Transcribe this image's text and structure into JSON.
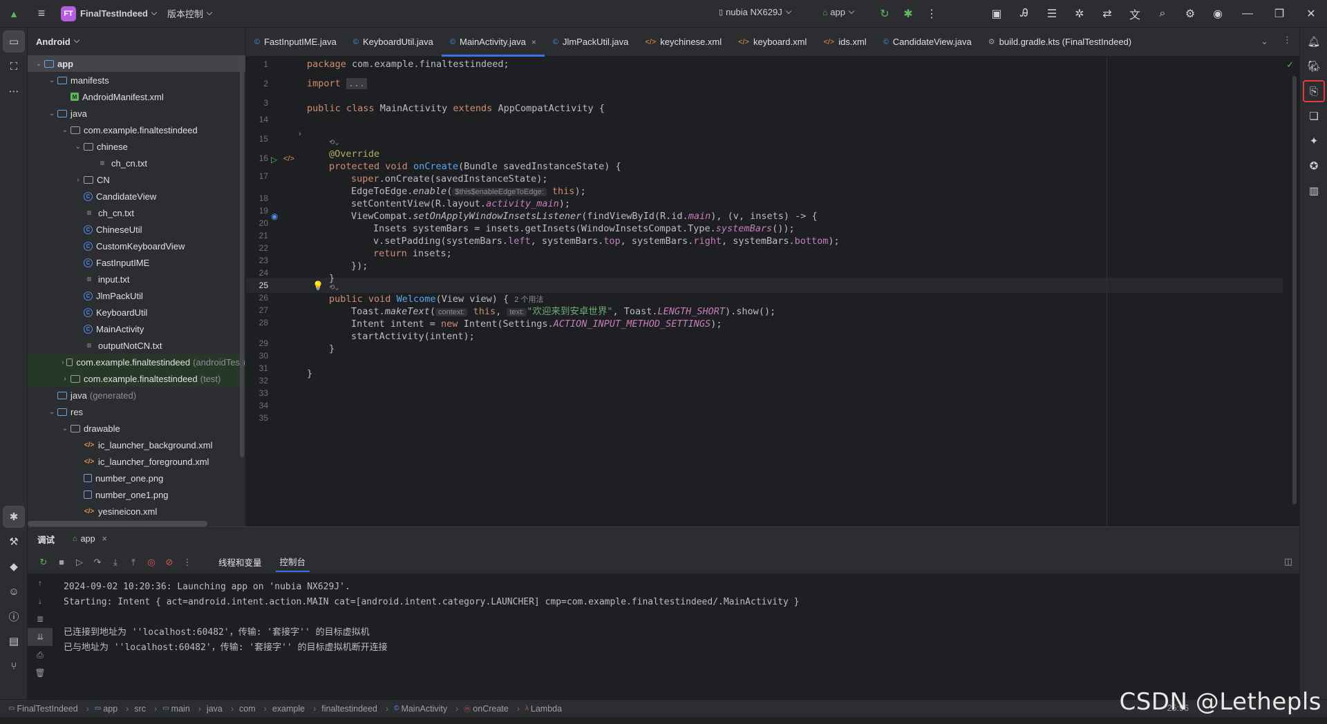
{
  "titlebar": {
    "project_badge": "FT",
    "project_name": "FinalTestIndeed",
    "vcs": "版本控制",
    "device": "nubia NX629J",
    "run_config": "app"
  },
  "project_panel": {
    "title": "Android",
    "tree": [
      {
        "label": "app",
        "indent": 0,
        "arrow": "v",
        "icon": "folder-module",
        "selected": true
      },
      {
        "label": "manifests",
        "indent": 1,
        "arrow": "v",
        "icon": "folder"
      },
      {
        "label": "AndroidManifest.xml",
        "indent": 2,
        "arrow": "",
        "icon": "manifest"
      },
      {
        "label": "java",
        "indent": 1,
        "arrow": "v",
        "icon": "folder"
      },
      {
        "label": "com.example.finaltestindeed",
        "indent": 2,
        "arrow": "v",
        "icon": "package"
      },
      {
        "label": "chinese",
        "indent": 3,
        "arrow": "v",
        "icon": "package"
      },
      {
        "label": "ch_cn.txt",
        "indent": 4,
        "arrow": "",
        "icon": "txt"
      },
      {
        "label": "CN",
        "indent": 3,
        "arrow": ">",
        "icon": "package"
      },
      {
        "label": "CandidateView",
        "indent": 3,
        "arrow": "",
        "icon": "class"
      },
      {
        "label": "ch_cn.txt",
        "indent": 3,
        "arrow": "",
        "icon": "txt"
      },
      {
        "label": "ChineseUtil",
        "indent": 3,
        "arrow": "",
        "icon": "class"
      },
      {
        "label": "CustomKeyboardView",
        "indent": 3,
        "arrow": "",
        "icon": "class"
      },
      {
        "label": "FastInputIME",
        "indent": 3,
        "arrow": "",
        "icon": "class"
      },
      {
        "label": "input.txt",
        "indent": 3,
        "arrow": "",
        "icon": "txt"
      },
      {
        "label": "JlmPackUtil",
        "indent": 3,
        "arrow": "",
        "icon": "class"
      },
      {
        "label": "KeyboardUtil",
        "indent": 3,
        "arrow": "",
        "icon": "class"
      },
      {
        "label": "MainActivity",
        "indent": 3,
        "arrow": "",
        "icon": "class"
      },
      {
        "label": "outputNotCN.txt",
        "indent": 3,
        "arrow": "",
        "icon": "txt"
      },
      {
        "label": "com.example.finaltestindeed",
        "suffix": "(androidTest)",
        "indent": 2,
        "arrow": ">",
        "icon": "package",
        "test": true
      },
      {
        "label": "com.example.finaltestindeed",
        "suffix": "(test)",
        "indent": 2,
        "arrow": ">",
        "icon": "package",
        "test": true
      },
      {
        "label": "java",
        "suffix": "(generated)",
        "indent": 1,
        "arrow": "",
        "icon": "folder"
      },
      {
        "label": "res",
        "indent": 1,
        "arrow": "v",
        "icon": "folder"
      },
      {
        "label": "drawable",
        "indent": 2,
        "arrow": "v",
        "icon": "package"
      },
      {
        "label": "ic_launcher_background.xml",
        "indent": 3,
        "arrow": "",
        "icon": "xml"
      },
      {
        "label": "ic_launcher_foreground.xml",
        "indent": 3,
        "arrow": "",
        "icon": "xml"
      },
      {
        "label": "number_one.png",
        "indent": 3,
        "arrow": "",
        "icon": "png"
      },
      {
        "label": "number_one1.png",
        "indent": 3,
        "arrow": "",
        "icon": "png"
      },
      {
        "label": "yesineicon.xml",
        "indent": 3,
        "arrow": "",
        "icon": "xml"
      }
    ]
  },
  "tabs": [
    {
      "label": "FastInputIME.java",
      "icon": "c"
    },
    {
      "label": "KeyboardUtil.java",
      "icon": "c"
    },
    {
      "label": "MainActivity.java",
      "icon": "c",
      "active": true
    },
    {
      "label": "JlmPackUtil.java",
      "icon": "c"
    },
    {
      "label": "keychinese.xml",
      "icon": "x"
    },
    {
      "label": "keyboard.xml",
      "icon": "x"
    },
    {
      "label": "ids.xml",
      "icon": "x"
    },
    {
      "label": "CandidateView.java",
      "icon": "c"
    },
    {
      "label": "build.gradle.kts (FinalTestIndeed)",
      "icon": "g"
    }
  ],
  "editor": {
    "line_numbers": [
      "1",
      "2",
      "3",
      "14",
      "15",
      "16",
      "17",
      "",
      "18",
      "19",
      "20",
      "21",
      "22",
      "23",
      "24",
      "25",
      "26",
      "27",
      "28",
      "",
      "29",
      "30",
      "31",
      "32",
      "33",
      "34",
      "35"
    ],
    "current_line": "25",
    "code": {
      "l1": [
        "package",
        " com.example.finaltestindeed;"
      ],
      "l3": [
        "import",
        "..."
      ],
      "l15": [
        "public",
        "class",
        "MainActivity",
        "extends",
        "AppCompatActivity {"
      ],
      "override": "@Override",
      "l19": [
        "protected",
        "void",
        "onCreate",
        "(Bundle savedInstanceState) {"
      ],
      "l20": [
        "super",
        ".onCreate(savedInstanceState);"
      ],
      "l21": [
        "EdgeToEdge.",
        "enable",
        "(",
        "$this$enableEdgeToEdge:",
        "this",
        ");"
      ],
      "l22": [
        "setContentView(R.layout.",
        "activity_main",
        ");"
      ],
      "l23": [
        "ViewCompat.",
        "setOnApplyWindowInsetsListener",
        "(findViewById(R.id.",
        "main",
        "), (v, insets) -> {"
      ],
      "l24": [
        "Insets systemBars = insets.getInsets(WindowInsetsCompat.Type.",
        "systemBars",
        "());"
      ],
      "l25": [
        "v.setPadding(systemBars.",
        "left",
        ", systemBars.",
        "top",
        ", systemBars.",
        "right",
        ", systemBars.",
        "bottom",
        ");"
      ],
      "l26": [
        "return",
        " insets;"
      ],
      "l27": "});",
      "l28": "}",
      "l29": [
        "public",
        "void",
        "Welcome",
        "(View view) {",
        "2 个用法"
      ],
      "l30": [
        "Toast.",
        "makeText",
        "(",
        "context:",
        "this",
        ", ",
        "text:",
        "\"欢迎来到安卓世界\"",
        ", Toast.",
        "LENGTH_SHORT",
        ").show();"
      ],
      "l31": [
        "Intent intent = ",
        "new",
        " Intent(Settings.",
        "ACTION_INPUT_METHOD_SETTINGS",
        ");"
      ],
      "l32": "startActivity(intent);",
      "l33": "}",
      "l35": "}"
    }
  },
  "bottom": {
    "panel_title": "调试",
    "run_tab": "app",
    "subtabs": [
      "线程和变量",
      "控制台"
    ],
    "console": [
      "2024-09-02 10:20:36: Launching app on 'nubia NX629J'.",
      "Starting: Intent { act=android.intent.action.MAIN cat=[android.intent.category.LAUNCHER] cmp=com.example.finaltestindeed/.MainActivity }",
      "",
      "已连接到地址为 ''localhost:60482'，传输: '套接字'' 的目标虚拟机",
      "已与地址为 ''localhost:60482'，传输: '套接字'' 的目标虚拟机断开连接"
    ]
  },
  "statusbar": {
    "breadcrumbs": [
      "FinalTestIndeed",
      "app",
      "src",
      "main",
      "java",
      "com",
      "example",
      "finaltestindeed",
      "MainActivity",
      "onCreate",
      "Lambda"
    ],
    "position": "25:96"
  },
  "watermark": "CSDN @Lethepls",
  "colors": {
    "accent": "#3574f0",
    "highlight_border": "#e03c3c",
    "badge": "#b45ee0"
  }
}
